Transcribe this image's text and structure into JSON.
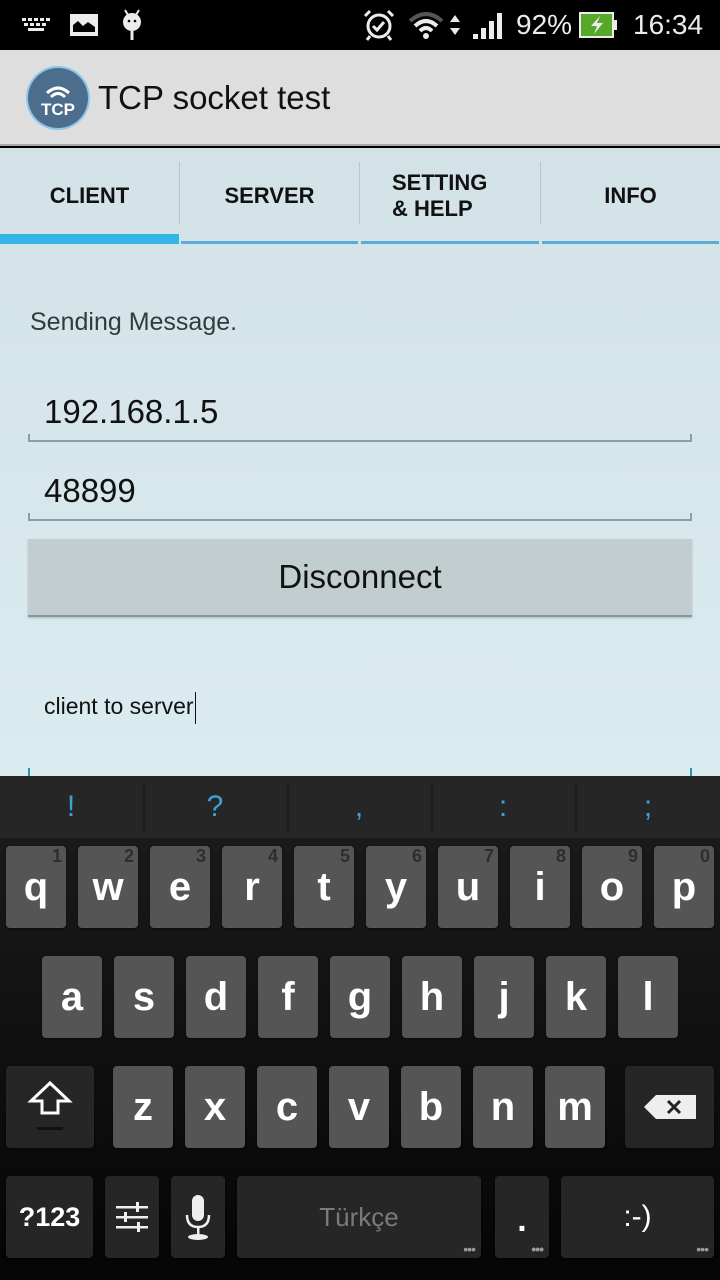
{
  "status_bar": {
    "icons_left": [
      "keyboard-icon",
      "image-icon",
      "android-debug-icon"
    ],
    "icons_right": [
      "alarm-icon",
      "wifi-icon",
      "data-transfer-icon",
      "signal-icon",
      "battery-charging-icon"
    ],
    "battery": "92%",
    "time": "16:34",
    "battery_color": "#56a829"
  },
  "app_bar": {
    "logo_text": "TCP",
    "title": "TCP socket test"
  },
  "tabs": [
    {
      "label": "CLIENT",
      "active": true
    },
    {
      "label": "SERVER",
      "active": false
    },
    {
      "label": "SETTING\n& HELP",
      "line1": "SETTING",
      "line2": "& HELP",
      "active": false
    },
    {
      "label": "INFO",
      "active": false
    }
  ],
  "client": {
    "status": "Sending Message.",
    "ip_value": "192.168.1.5",
    "port_value": "48899",
    "disconnect_label": "Disconnect",
    "message_value": "client to server"
  },
  "keyboard": {
    "suggestions": [
      "!",
      "?",
      ",",
      ":",
      ";"
    ],
    "row1": [
      {
        "k": "q",
        "h": "1"
      },
      {
        "k": "w",
        "h": "2"
      },
      {
        "k": "e",
        "h": "3"
      },
      {
        "k": "r",
        "h": "4"
      },
      {
        "k": "t",
        "h": "5"
      },
      {
        "k": "y",
        "h": "6"
      },
      {
        "k": "u",
        "h": "7"
      },
      {
        "k": "i",
        "h": "8"
      },
      {
        "k": "o",
        "h": "9"
      },
      {
        "k": "p",
        "h": "0"
      }
    ],
    "row2": [
      "a",
      "s",
      "d",
      "f",
      "g",
      "h",
      "j",
      "k",
      "l"
    ],
    "row3": [
      "z",
      "x",
      "c",
      "v",
      "b",
      "n",
      "m"
    ],
    "symbols_label": "?123",
    "space_label": "Türkçe",
    "period_label": ".",
    "emoticon_label": ":-)",
    "accent_color": "#33b5e5"
  }
}
